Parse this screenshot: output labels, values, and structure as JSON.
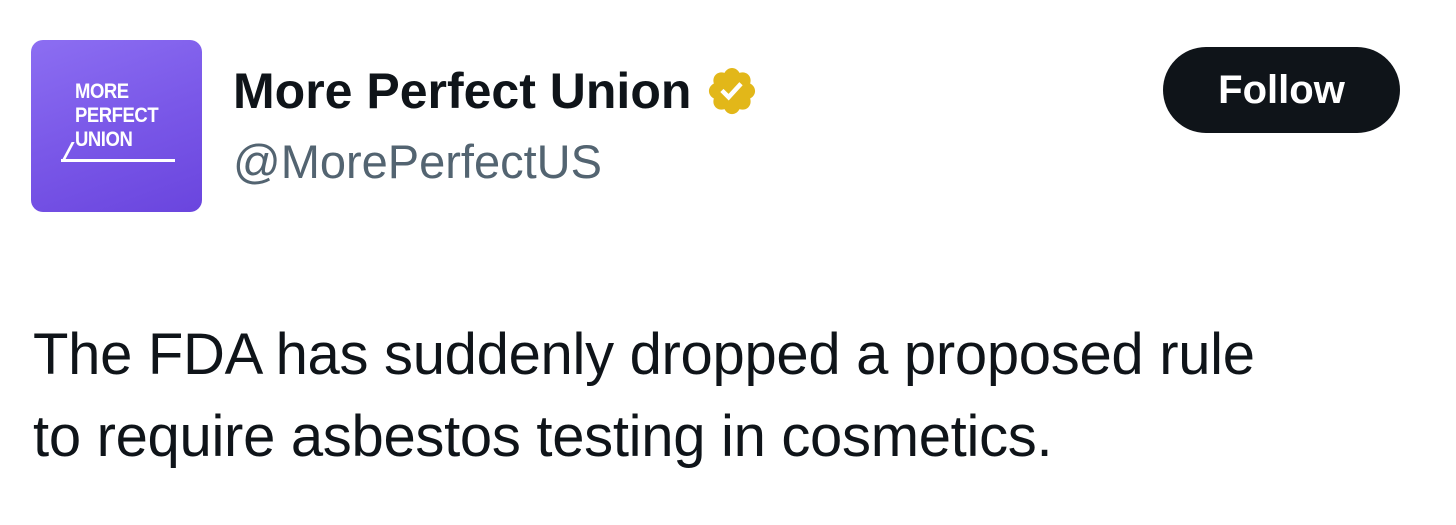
{
  "author": {
    "avatar": {
      "logo_lines": [
        "MORE",
        "PERFECT",
        "UNION"
      ],
      "background_color": "#7a58e8",
      "logo_color": "#ffffff"
    },
    "display_name": "More Perfect Union",
    "verified_badge_icon": "verified-check-icon",
    "verified_badge_color": "#e2b719",
    "handle": "@MorePerfectUS"
  },
  "actions": {
    "follow_label": "Follow"
  },
  "tweet": {
    "text_lines": [
      "The FDA has suddenly dropped a proposed rule",
      "to require asbestos testing in cosmetics."
    ]
  },
  "colors": {
    "text_primary": "#0f1419",
    "text_secondary": "#536471",
    "button_background": "#0f1419",
    "button_text": "#ffffff"
  }
}
